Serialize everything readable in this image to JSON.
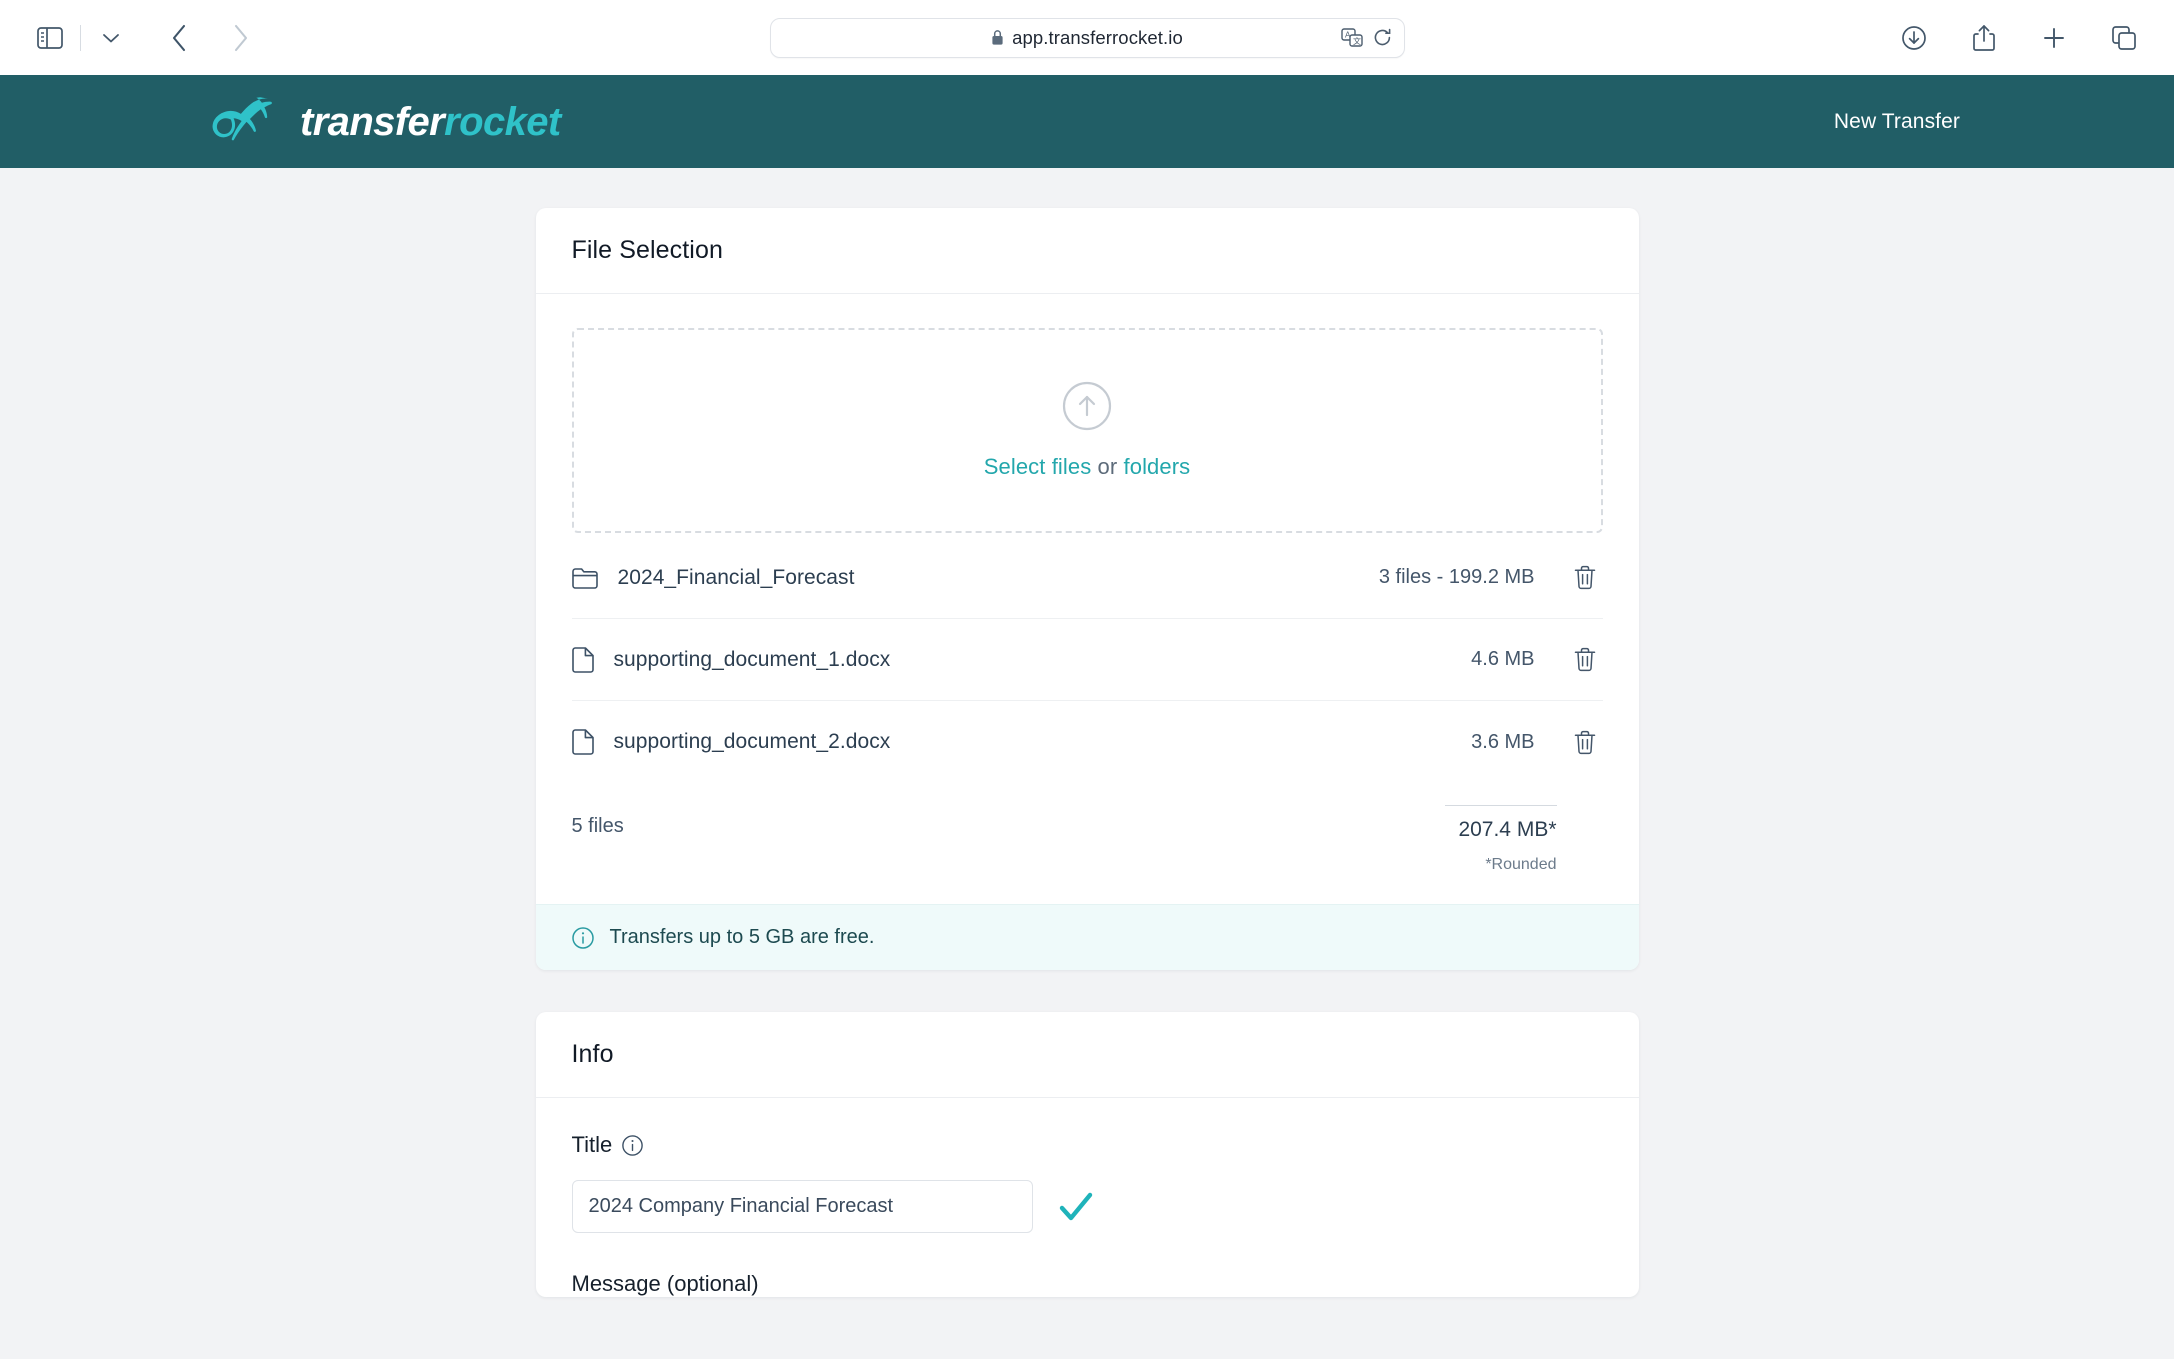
{
  "browser": {
    "url": "app.transferrocket.io",
    "lock_icon": "lock-icon",
    "sidebar_icon": "sidebar-toggle-icon",
    "chevron_icon": "chevron-down-icon",
    "back_icon": "back-arrow-icon",
    "forward_icon": "forward-arrow-icon",
    "translate_icon": "translate-icon",
    "reload_icon": "reload-icon",
    "downloads_icon": "downloads-icon",
    "share_icon": "share-icon",
    "new_tab_icon": "plus-icon",
    "tabs_icon": "tab-overview-icon"
  },
  "header": {
    "brand_part_a": "transfer",
    "brand_part_b": "rocket",
    "logo_icon": "rocket-logo-icon",
    "new_transfer_label": "New Transfer",
    "bg_color": "#215e66",
    "accent_color": "#2fc2c9"
  },
  "file_selection": {
    "title": "File Selection",
    "dropzone": {
      "upload_icon": "upload-arrow-circle-icon",
      "link_files": "Select files",
      "separator": " or ",
      "link_folders": "folders"
    },
    "files": [
      {
        "icon": "folder-icon",
        "name": "2024_Financial_Forecast",
        "meta": "3 files - 199.2 MB",
        "delete_icon": "trash-icon"
      },
      {
        "icon": "file-icon",
        "name": "supporting_document_1.docx",
        "meta": "4.6 MB",
        "delete_icon": "trash-icon"
      },
      {
        "icon": "file-icon",
        "name": "supporting_document_2.docx",
        "meta": "3.6 MB",
        "delete_icon": "trash-icon"
      }
    ],
    "totals": {
      "count_label": "5 files",
      "size_label": "207.4 MB*",
      "note": "*Rounded"
    },
    "banner": {
      "icon": "info-circle-icon",
      "text": "Transfers up to 5 GB are free.",
      "bg_color": "#effafa",
      "text_color": "#1d4a50"
    }
  },
  "info": {
    "title": "Info",
    "title_field": {
      "label": "Title",
      "info_icon": "info-circle-icon",
      "value": "2024 Company Financial Forecast",
      "placeholder": "Title",
      "valid_icon": "check-icon"
    },
    "message_field": {
      "label": "Message (optional)"
    }
  }
}
